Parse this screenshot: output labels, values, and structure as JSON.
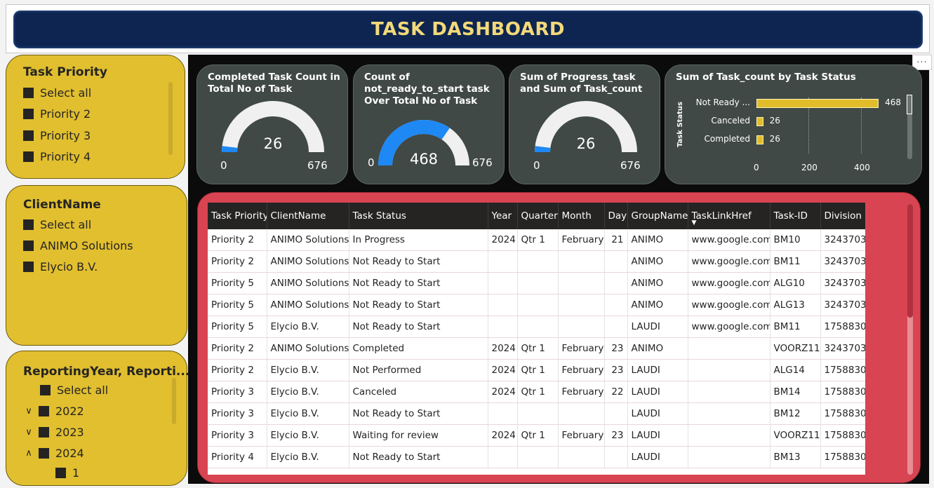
{
  "header": {
    "title": "TASK DASHBOARD"
  },
  "slicers": {
    "priority": {
      "title": "Task Priority",
      "items": [
        "Select all",
        "Priority 2",
        "Priority 3",
        "Priority 4"
      ]
    },
    "client": {
      "title": "ClientName",
      "items": [
        "Select all",
        "ANIMO Solutions",
        "Elycio B.V."
      ]
    },
    "period": {
      "title": "ReportingYear, Reporti...",
      "select_all": "Select all",
      "years": [
        "2022",
        "2023",
        "2024"
      ],
      "child": "1"
    }
  },
  "more_options": "...",
  "cards": {
    "completed": {
      "title": "Completed Task Count in Total No of Task",
      "value": "26",
      "min": "0",
      "max": "676",
      "fraction": 0.0385
    },
    "not_ready": {
      "title": "Count of not_ready_to_start task Over Total No of Task",
      "value": "468",
      "min": "0",
      "max": "676",
      "fraction": 0.692
    },
    "progress": {
      "title": "Sum of Progress_task and Sum of Task_count",
      "value": "26",
      "min": "0",
      "max": "676",
      "fraction": 0.0385
    },
    "status_bar": {
      "title": "Sum of Task_count by Task Status",
      "axis_title": "Task Status",
      "ticks": [
        "0",
        "200",
        "400"
      ]
    }
  },
  "chart_data": {
    "type": "bar",
    "title": "Sum of Task_count by Task Status",
    "ylabel": "Task Status",
    "categories": [
      "Not Ready ...",
      "Canceled",
      "Completed"
    ],
    "values": [
      468,
      26,
      26
    ],
    "xlim": [
      0,
      500
    ]
  },
  "table": {
    "columns": [
      "Task Priority",
      "ClientName",
      "Task Status",
      "Year",
      "Quarter",
      "Month",
      "Day",
      "GroupName",
      "TaskLinkHref",
      "Task-ID",
      "Division"
    ],
    "rows": [
      [
        "Priority 2",
        "ANIMO Solutions",
        "In Progress",
        "2024",
        "Qtr 1",
        "February",
        "21",
        "ANIMO",
        "www.google.com",
        "BM10",
        "3243703"
      ],
      [
        "Priority 2",
        "ANIMO Solutions",
        "Not Ready to Start",
        "",
        "",
        "",
        "",
        "ANIMO",
        "www.google.com",
        "BM11",
        "3243703"
      ],
      [
        "Priority 5",
        "ANIMO Solutions",
        "Not Ready to Start",
        "",
        "",
        "",
        "",
        "ANIMO",
        "www.google.com",
        "ALG10",
        "3243703"
      ],
      [
        "Priority 5",
        "ANIMO Solutions",
        "Not Ready to Start",
        "",
        "",
        "",
        "",
        "ANIMO",
        "www.google.com",
        "ALG13",
        "3243703"
      ],
      [
        "Priority 5",
        "Elycio B.V.",
        "Not Ready to Start",
        "",
        "",
        "",
        "",
        "LAUDI",
        "www.google.com",
        "BM11",
        "1758830"
      ],
      [
        "Priority 2",
        "ANIMO Solutions",
        "Completed",
        "2024",
        "Qtr 1",
        "February",
        "23",
        "ANIMO",
        "",
        "VOORZ11",
        "3243703"
      ],
      [
        "Priority 2",
        "Elycio B.V.",
        "Not Performed",
        "2024",
        "Qtr 1",
        "February",
        "23",
        "LAUDI",
        "",
        "ALG14",
        "1758830"
      ],
      [
        "Priority 3",
        "Elycio B.V.",
        "Canceled",
        "2024",
        "Qtr 1",
        "February",
        "22",
        "LAUDI",
        "",
        "BM14",
        "1758830"
      ],
      [
        "Priority 3",
        "Elycio B.V.",
        "Not Ready to Start",
        "",
        "",
        "",
        "",
        "LAUDI",
        "",
        "BM12",
        "1758830"
      ],
      [
        "Priority 3",
        "Elycio B.V.",
        "Waiting for review",
        "2024",
        "Qtr 1",
        "February",
        "23",
        "LAUDI",
        "",
        "VOORZ11",
        "1758830"
      ],
      [
        "Priority 4",
        "Elycio B.V.",
        "Not Ready to Start",
        "",
        "",
        "",
        "",
        "LAUDI",
        "",
        "BM13",
        "1758830"
      ]
    ]
  }
}
